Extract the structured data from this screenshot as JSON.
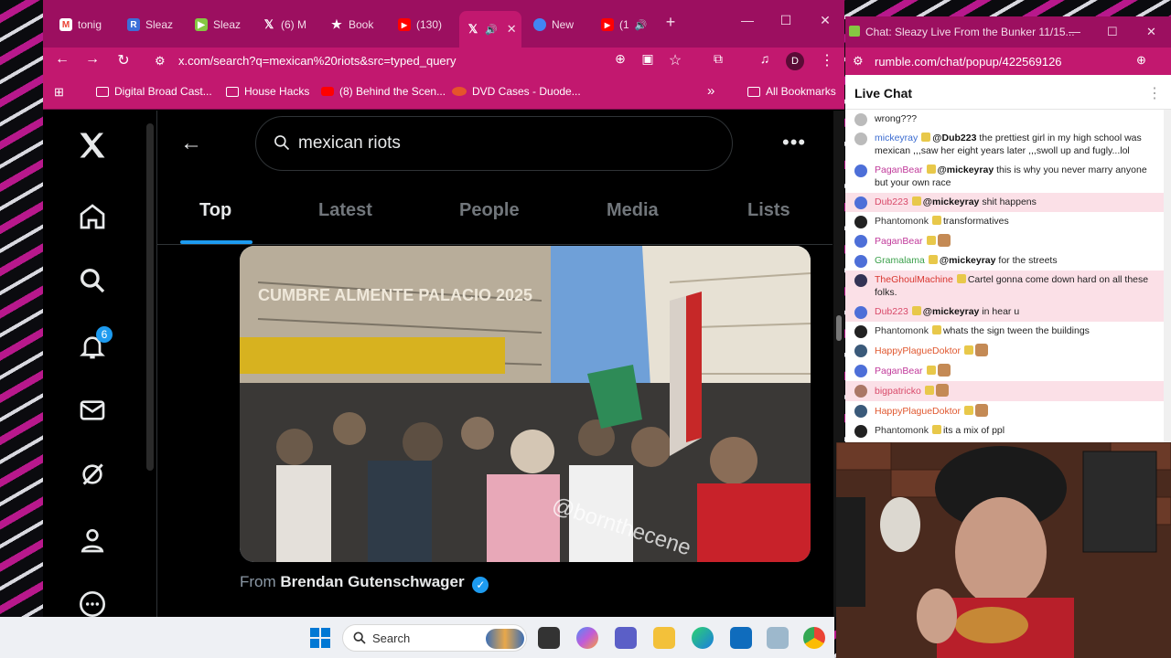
{
  "browser": {
    "tabs": [
      {
        "label": "tonig",
        "icon": "gmail-icon",
        "color": "#ea4335"
      },
      {
        "label": "Sleaz",
        "icon": "reddit-r-icon",
        "color": "#3b6fd8"
      },
      {
        "label": "Sleaz",
        "icon": "rumble-icon",
        "color": "#85c742"
      },
      {
        "label": "(6) M",
        "icon": "x-icon",
        "color": "#000000"
      },
      {
        "label": "Book",
        "icon": "star-icon",
        "color": "#ffffff"
      },
      {
        "label": "(130)",
        "icon": "youtube-icon",
        "color": "#ff0000"
      },
      {
        "label": "",
        "icon": "x-icon",
        "color": "#000000",
        "active": true
      },
      {
        "label": "New",
        "icon": "chrome-icon",
        "color": "#4285f4"
      },
      {
        "label": "(1",
        "icon": "youtube-icon",
        "color": "#ff0000"
      }
    ],
    "new_tab": "+",
    "url": "x.com/search?q=mexican%20riots&src=typed_query",
    "profile_initial": "D",
    "bookmarks": [
      {
        "label": "Digital Broad Cast...",
        "icon": "folder-icon"
      },
      {
        "label": "House Hacks",
        "icon": "folder-icon"
      },
      {
        "label": "(8) Behind the Scen...",
        "icon": "youtube-icon"
      },
      {
        "label": "DVD Cases - Duode...",
        "icon": "dvd-icon"
      }
    ],
    "all_bookmarks": "All Bookmarks",
    "more_bookmarks": "»"
  },
  "x": {
    "search_query": "mexican riots",
    "notification_count": "6",
    "tabs": [
      "Top",
      "Latest",
      "People",
      "Media",
      "Lists"
    ],
    "selected_tab": "Top",
    "media_watermark": "@bornthecene",
    "sign_text": "CUMBRE ALMENTE PALACIO 2025",
    "from_prefix": "From",
    "from_name": "Brendan Gutenschwager"
  },
  "chat": {
    "window_title": "Chat: Sleazy Live From the Bunker 11/15...",
    "url": "rumble.com/chat/popup/422569126",
    "header": "Live Chat",
    "messages": [
      {
        "user": "",
        "text": "wrong???",
        "user_color": "#111111",
        "highlight": false,
        "avatar": "#bbbbbb"
      },
      {
        "user": "mickeyray",
        "mention": "@Dub223",
        "text": "the prettiest girl in my high school was mexican ,,,saw her eight years later ,,,swoll up and fugly...lol",
        "user_color": "#3a6bd0",
        "highlight": false,
        "avatar": "#bbbbbb"
      },
      {
        "user": "PaganBear",
        "mention": "@mickeyray",
        "text": "this is why you never marry anyone but your own race",
        "user_color": "#c0399a",
        "highlight": false,
        "avatar": "#4d6fd8"
      },
      {
        "user": "Dub223",
        "mention": "@mickeyray",
        "text": "shit happens",
        "user_color": "#d94a6a",
        "highlight": true,
        "avatar": "#4d6fd8"
      },
      {
        "user": "Phantomonk",
        "mention": "",
        "text": "transformatives",
        "user_color": "#333333",
        "highlight": false,
        "avatar": "#222222"
      },
      {
        "user": "PaganBear",
        "mention": "",
        "text": "",
        "user_color": "#c0399a",
        "highlight": false,
        "avatar": "#4d6fd8"
      },
      {
        "user": "Gramalama",
        "mention": "@mickeyray",
        "text": "for the streets",
        "user_color": "#3aa04a",
        "highlight": false,
        "avatar": "#4d6fd8"
      },
      {
        "user": "TheGhoulMachine",
        "mention": "",
        "text": "Cartel gonna come down hard on all these folks.",
        "user_color": "#d9362f",
        "highlight": true,
        "avatar": "#333355"
      },
      {
        "user": "Dub223",
        "mention": "@mickeyray",
        "text": "in hear u",
        "user_color": "#d94a6a",
        "highlight": true,
        "avatar": "#4d6fd8"
      },
      {
        "user": "Phantomonk",
        "mention": "",
        "text": "whats the sign tween the buildings",
        "user_color": "#333333",
        "highlight": false,
        "avatar": "#222222"
      },
      {
        "user": "HappyPlagueDoktor",
        "mention": "",
        "text": "",
        "user_color": "#e0582f",
        "highlight": false,
        "avatar": "#3a5a7a"
      },
      {
        "user": "PaganBear",
        "mention": "",
        "text": "",
        "user_color": "#c0399a",
        "highlight": false,
        "avatar": "#4d6fd8"
      },
      {
        "user": "bigpatricko",
        "mention": "",
        "text": "",
        "user_color": "#d94a6a",
        "highlight": true,
        "avatar": "#aa7766"
      },
      {
        "user": "HappyPlagueDoktor",
        "mention": "",
        "text": "",
        "user_color": "#e0582f",
        "highlight": false,
        "avatar": "#3a5a7a"
      },
      {
        "user": "Phantomonk",
        "mention": "",
        "text": "its a mix of ppl",
        "user_color": "#333333",
        "highlight": false,
        "avatar": "#222222"
      }
    ]
  },
  "taskbar": {
    "search_label": "Search"
  }
}
